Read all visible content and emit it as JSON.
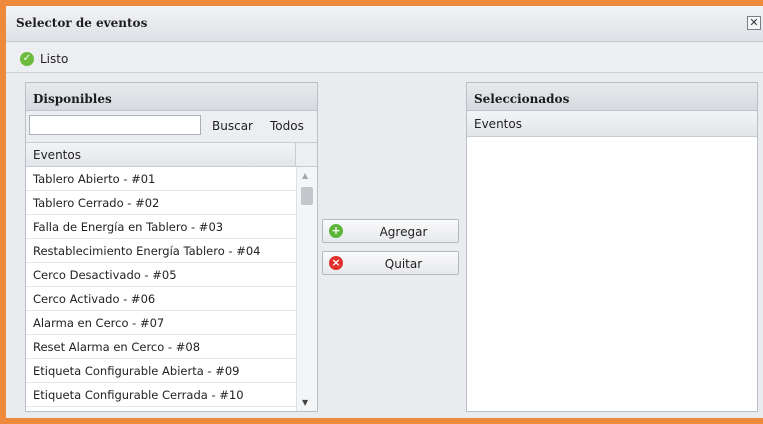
{
  "dialog": {
    "title": "Selector de eventos",
    "close_glyph": "✕"
  },
  "toolbar": {
    "done_label": "Listo",
    "done_icon": "check-circle-icon",
    "done_color": "#6cbb3c"
  },
  "available": {
    "title": "Disponibles",
    "search_value": "",
    "search_label": "Buscar",
    "all_label": "Todos",
    "column_header": "Eventos",
    "items": [
      "Tablero Abierto - #01",
      "Tablero Cerrado - #02",
      "Falla de Energía en Tablero - #03",
      "Restablecimiento Energía Tablero - #04",
      "Cerco Desactivado - #05",
      "Cerco Activado - #06",
      "Alarma en Cerco - #07",
      "Reset Alarma en Cerco - #08",
      "Etiqueta Configurable Abierta - #09",
      "Etiqueta Configurable Cerrada - #10"
    ]
  },
  "actions": {
    "add_label": "Agregar",
    "add_icon": "plus-circle-icon",
    "add_color": "#5cb63a",
    "remove_label": "Quitar",
    "remove_icon": "x-circle-icon",
    "remove_color": "#e0302d"
  },
  "selected": {
    "title": "Seleccionados",
    "column_header": "Eventos",
    "items": []
  },
  "colors": {
    "frame_accent": "#ef8a3c"
  }
}
